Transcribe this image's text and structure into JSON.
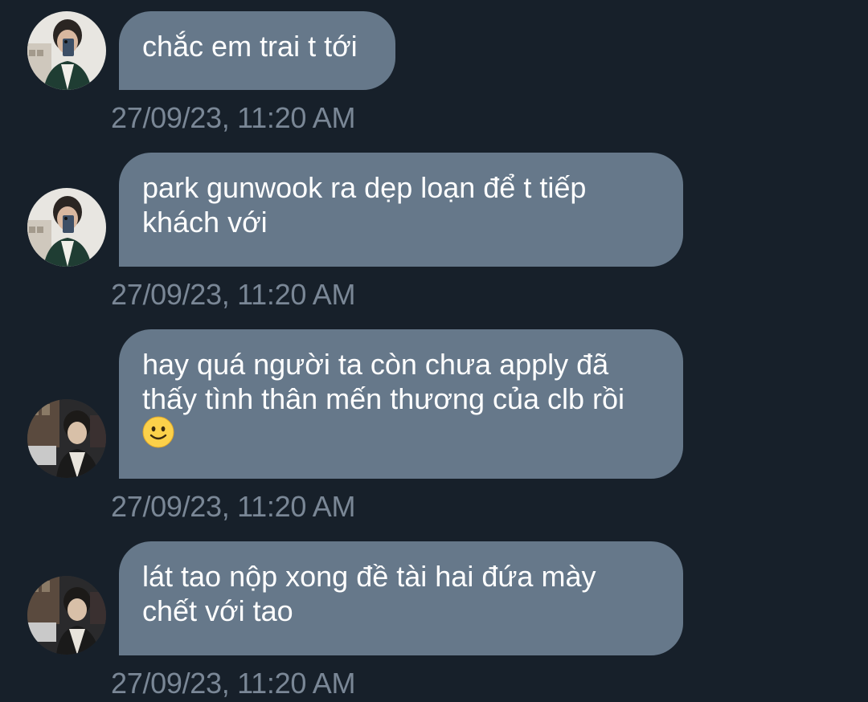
{
  "colors": {
    "background": "#17202a",
    "bubble": "#66788a",
    "bubble_text": "#ffffff",
    "timestamp": "#7a8796"
  },
  "messages": [
    {
      "avatar": "avatar-user-a",
      "lines": [
        "chắc em trai t tới"
      ],
      "timestamp": "27/09/23, 11:20 AM"
    },
    {
      "avatar": "avatar-user-a",
      "lines": [
        "park gunwook ra dẹp loạn để t tiếp",
        "khách với"
      ],
      "timestamp": "27/09/23, 11:20 AM"
    },
    {
      "avatar": "avatar-user-b",
      "lines": [
        "hay quá người ta còn chưa apply đã",
        "thấy tình thân mến thương của clb rồi",
        ""
      ],
      "emoji": "slightly-smiling-face-icon",
      "timestamp": "27/09/23, 11:20 AM"
    },
    {
      "avatar": "avatar-user-b",
      "lines": [
        "lát tao nộp xong đề tài hai đứa mày",
        "chết với tao"
      ],
      "timestamp": "27/09/23, 11:20 AM"
    }
  ]
}
